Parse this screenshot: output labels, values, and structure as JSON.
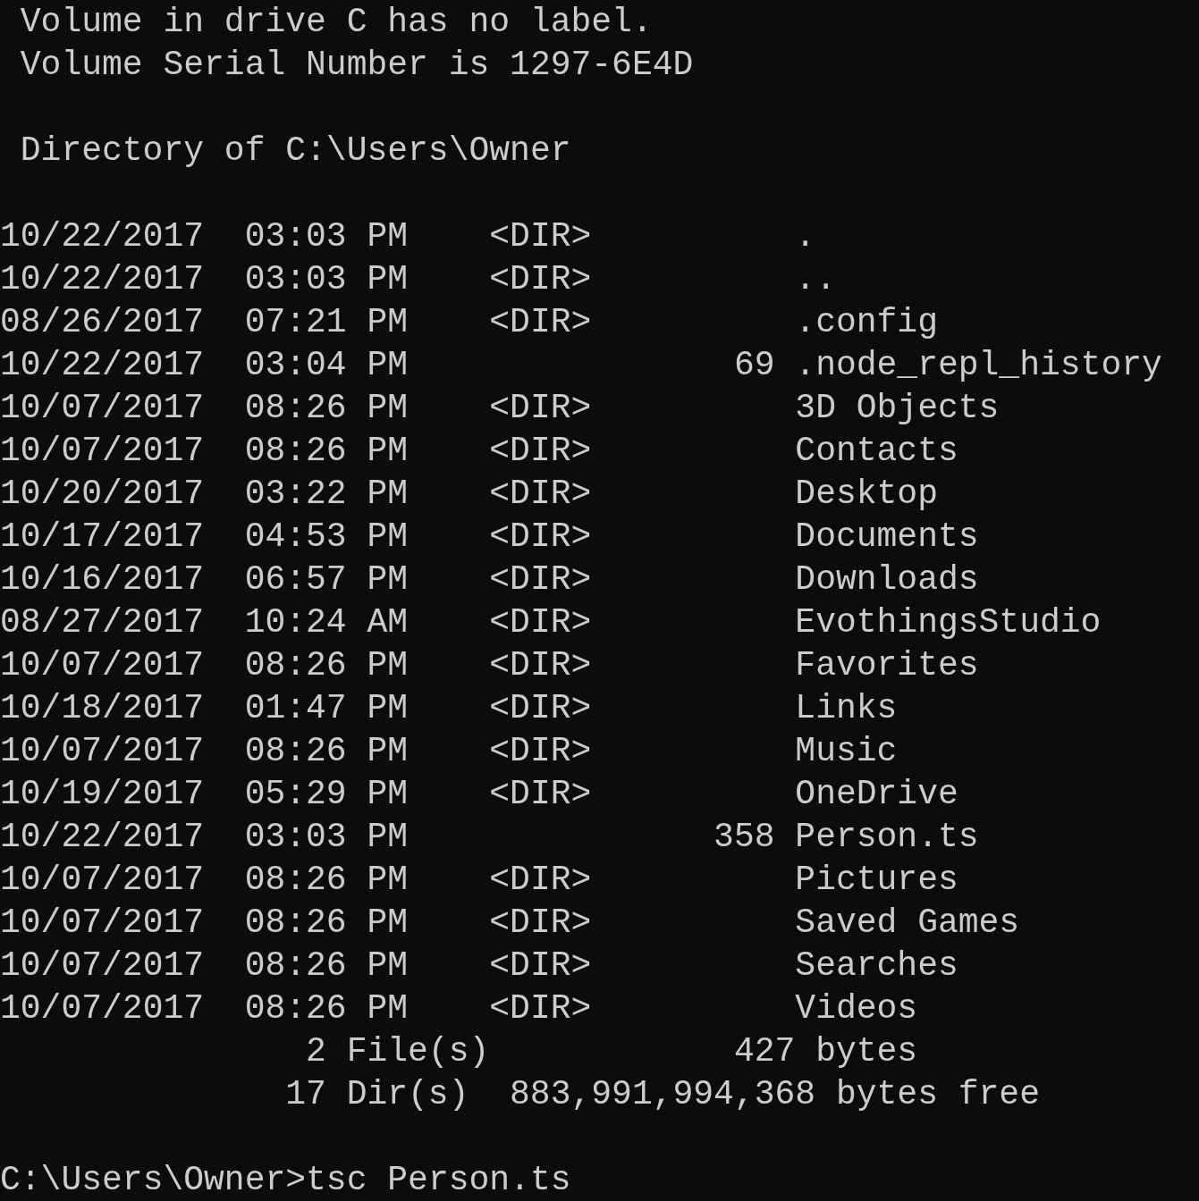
{
  "header": {
    "volume_label": "Volume in drive C has no label.",
    "serial": "Volume Serial Number is 1297-6E4D",
    "directory": "Directory of C:\\Users\\Owner"
  },
  "entries": [
    {
      "date": "10/22/2017",
      "time": "03:03 PM",
      "kind": "dir",
      "tag": "<DIR>",
      "name": "."
    },
    {
      "date": "10/22/2017",
      "time": "03:03 PM",
      "kind": "dir",
      "tag": "<DIR>",
      "name": ".."
    },
    {
      "date": "08/26/2017",
      "time": "07:21 PM",
      "kind": "dir",
      "tag": "<DIR>",
      "name": ".config"
    },
    {
      "date": "10/22/2017",
      "time": "03:04 PM",
      "kind": "file",
      "size": "69",
      "name": ".node_repl_history"
    },
    {
      "date": "10/07/2017",
      "time": "08:26 PM",
      "kind": "dir",
      "tag": "<DIR>",
      "name": "3D Objects"
    },
    {
      "date": "10/07/2017",
      "time": "08:26 PM",
      "kind": "dir",
      "tag": "<DIR>",
      "name": "Contacts"
    },
    {
      "date": "10/20/2017",
      "time": "03:22 PM",
      "kind": "dir",
      "tag": "<DIR>",
      "name": "Desktop"
    },
    {
      "date": "10/17/2017",
      "time": "04:53 PM",
      "kind": "dir",
      "tag": "<DIR>",
      "name": "Documents"
    },
    {
      "date": "10/16/2017",
      "time": "06:57 PM",
      "kind": "dir",
      "tag": "<DIR>",
      "name": "Downloads"
    },
    {
      "date": "08/27/2017",
      "time": "10:24 AM",
      "kind": "dir",
      "tag": "<DIR>",
      "name": "EvothingsStudio"
    },
    {
      "date": "10/07/2017",
      "time": "08:26 PM",
      "kind": "dir",
      "tag": "<DIR>",
      "name": "Favorites"
    },
    {
      "date": "10/18/2017",
      "time": "01:47 PM",
      "kind": "dir",
      "tag": "<DIR>",
      "name": "Links"
    },
    {
      "date": "10/07/2017",
      "time": "08:26 PM",
      "kind": "dir",
      "tag": "<DIR>",
      "name": "Music"
    },
    {
      "date": "10/19/2017",
      "time": "05:29 PM",
      "kind": "dir",
      "tag": "<DIR>",
      "name": "OneDrive"
    },
    {
      "date": "10/22/2017",
      "time": "03:03 PM",
      "kind": "file",
      "size": "358",
      "name": "Person.ts"
    },
    {
      "date": "10/07/2017",
      "time": "08:26 PM",
      "kind": "dir",
      "tag": "<DIR>",
      "name": "Pictures"
    },
    {
      "date": "10/07/2017",
      "time": "08:26 PM",
      "kind": "dir",
      "tag": "<DIR>",
      "name": "Saved Games"
    },
    {
      "date": "10/07/2017",
      "time": "08:26 PM",
      "kind": "dir",
      "tag": "<DIR>",
      "name": "Searches"
    },
    {
      "date": "10/07/2017",
      "time": "08:26 PM",
      "kind": "dir",
      "tag": "<DIR>",
      "name": "Videos"
    }
  ],
  "summary": [
    {
      "kind": "files",
      "count": "2",
      "label": "File(s)",
      "amount": "427",
      "unit": "bytes"
    },
    {
      "kind": "dirs",
      "count": "17",
      "label": "Dir(s)",
      "amount": "883,991,994,368",
      "unit": "bytes free"
    }
  ],
  "prompt": {
    "path": "C:\\Users\\Owner>",
    "command": "tsc Person.ts"
  }
}
